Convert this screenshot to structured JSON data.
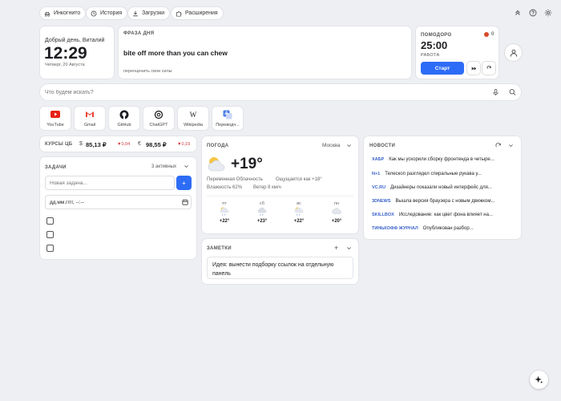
{
  "toolbar": {
    "incognito": "Инкогнито",
    "history": "История",
    "downloads": "Загрузки",
    "extensions": "Расширения"
  },
  "greeting": {
    "text": "Добрый день, Виталий",
    "time": "12:29",
    "date": "Четверг, 20 Августа"
  },
  "phrase": {
    "label": "ФРАЗА ДНЯ",
    "text": "bite off more than you can chew",
    "translation": "переоценить свои силы"
  },
  "pomodoro": {
    "label": "ПОМОДОРО",
    "count": "0",
    "time": "25:00",
    "status": "РАБОТА",
    "start_label": "Старт"
  },
  "search": {
    "placeholder": "Что будем искать?"
  },
  "shortcuts": [
    {
      "label": "YouTube",
      "icon": "youtube-icon"
    },
    {
      "label": "Gmail",
      "icon": "gmail-icon"
    },
    {
      "label": "GitHub",
      "icon": "github-icon"
    },
    {
      "label": "ChatGPT",
      "icon": "chatgpt-icon"
    },
    {
      "label": "Wikipedia",
      "icon": "wikipedia-icon"
    },
    {
      "label": "Переводч...",
      "icon": "translate-icon"
    }
  ],
  "rates": {
    "label": "КУРСЫ ЦБ",
    "usd_symbol": "$",
    "usd": "85,13 ₽",
    "usd_change": "▼0,04",
    "eur_symbol": "€",
    "eur": "98,55 ₽",
    "eur_change": "▼0,19"
  },
  "tasks": {
    "label": "ЗАДАЧИ",
    "count": "3 активных",
    "new_placeholder": "Новая задача...",
    "add_label": "+",
    "date_placeholder": "дд.мм.гггг, --:--"
  },
  "weather": {
    "label": "ПОГОДА",
    "city": "Москва",
    "temp": "+19°",
    "condition": "Переменная Облачность",
    "feels": "Ощущается как +18°",
    "humidity": "Влажность 62%",
    "wind": "Ветер 8 км/ч",
    "forecast": [
      {
        "day": "пт",
        "temp": "+22°"
      },
      {
        "day": "сб",
        "temp": "+23°"
      },
      {
        "day": "вс",
        "temp": "+22°"
      },
      {
        "day": "пн",
        "temp": "+20°"
      }
    ]
  },
  "notes": {
    "label": "ЗАМЕТКИ",
    "add": "+",
    "text": "Идея: вынести подборку ссылок на отдельную панель"
  },
  "news": {
    "label": "НОВОСТИ",
    "items": [
      {
        "source": "ХАБР",
        "title": "Как мы ускорили сборку фронтенда в четыре..."
      },
      {
        "source": "N+1",
        "title": "Телескоп разглядел спиральные рукава у..."
      },
      {
        "source": "VC.RU",
        "title": "Дизайнеры показали новый интерфейс для..."
      },
      {
        "source": "3DNEWS",
        "title": "Вышла версия браузера с новым движком..."
      },
      {
        "source": "SKILLBOX",
        "title": "Исследование: как цвет фона влияет на..."
      },
      {
        "source": "ТИНЬКОФФ ЖУРНАЛ",
        "title": "Опубликован разбор..."
      }
    ]
  },
  "colors": {
    "accent": "#2d6cf6",
    "down": "#d2383d"
  }
}
